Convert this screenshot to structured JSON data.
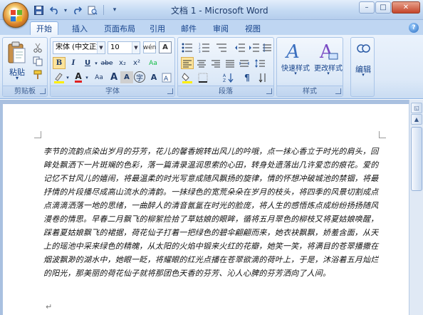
{
  "window": {
    "title": "文档 1 - Microsoft Word",
    "controls": {
      "minimize": "–",
      "restore": "□",
      "close": "✕"
    }
  },
  "qat": {
    "save_icon": "save-icon",
    "undo_icon": "undo-icon",
    "redo_icon": "redo-icon",
    "print_preview_icon": "print-preview-icon",
    "customize": "▾"
  },
  "tabs": [
    {
      "label": "开始",
      "active": true
    },
    {
      "label": "插入"
    },
    {
      "label": "页面布局"
    },
    {
      "label": "引用"
    },
    {
      "label": "邮件"
    },
    {
      "label": "审阅"
    },
    {
      "label": "视图"
    }
  ],
  "help": "?",
  "ribbon": {
    "clipboard": {
      "label": "剪贴板",
      "paste_label": "粘贴",
      "paste_arrow": "▾"
    },
    "font": {
      "label": "字体",
      "font_name": "宋体 (中文正文)",
      "font_size": "10",
      "bold": "B",
      "italic": "I",
      "underline": "U",
      "strike": "abe",
      "subscript": "x₂",
      "superscript": "x²",
      "clear_format": "Aa",
      "phonetic": "wén",
      "char_border": "A",
      "font_color": "A",
      "grow": "A",
      "shrink": "A",
      "char_shading": "A",
      "enclose": "字",
      "case": "Aa"
    },
    "paragraph": {
      "label": "段落"
    },
    "styles": {
      "label": "样式",
      "quick_styles": "快速样式",
      "change_styles": "更改样式"
    },
    "editing": {
      "label": "编辑"
    }
  },
  "document": {
    "body": "李节的流韵点染出岁月的芬芳，花儿的馨香婉转出风儿的吟哦，点一抹心香立于时光的肩头，回眸处飘洒下一片斑斓的色彩，落一篇清录温润思索的心田，转身处遗落出几许爱恋的痕花。爱的记忆不甘风儿的嬉闹，将最温柔的时光写意成随风飘扬的旋律，情的怀想冲破城池的禁锢，将最抒情的片段播尽成高山流水的清韵。一抹绿色的宽荒朵朵在岁月的枝头，将四季的风景切割成点点滴滴洒落一地的思绪，一曲醉人的清音氤氲在时光的脸庞，将人生的感悟炼点成纷纷扬扬随风漫卷的情思。早春二月飘飞的柳絮捡拾了草姑娘的眼眸，循将五月翠色的柳枝又将夏姑娘唤醒，踩着夏姑娘飘飞的裙据，荷花仙子打着一把绿色的碧伞翩翩而来，她衣袂飘飘，娇羞含面，从天上的瑶池中采来绿色的精魄，从太阳的火焰中锻来火红的花瓣，她笑一笑，将满目的苍翠播撒在烟波飘渺的湖水中，她眼一眨，将耀眼的红光点播在苍翠欲滴的荷叶上，于是，沐浴着五月灿烂的阳光，那美丽的荷花仙子就将那团色天香的芬芳、沁人心脾的芬芳洒向了人间。",
    "trailing_mark": "↵"
  }
}
